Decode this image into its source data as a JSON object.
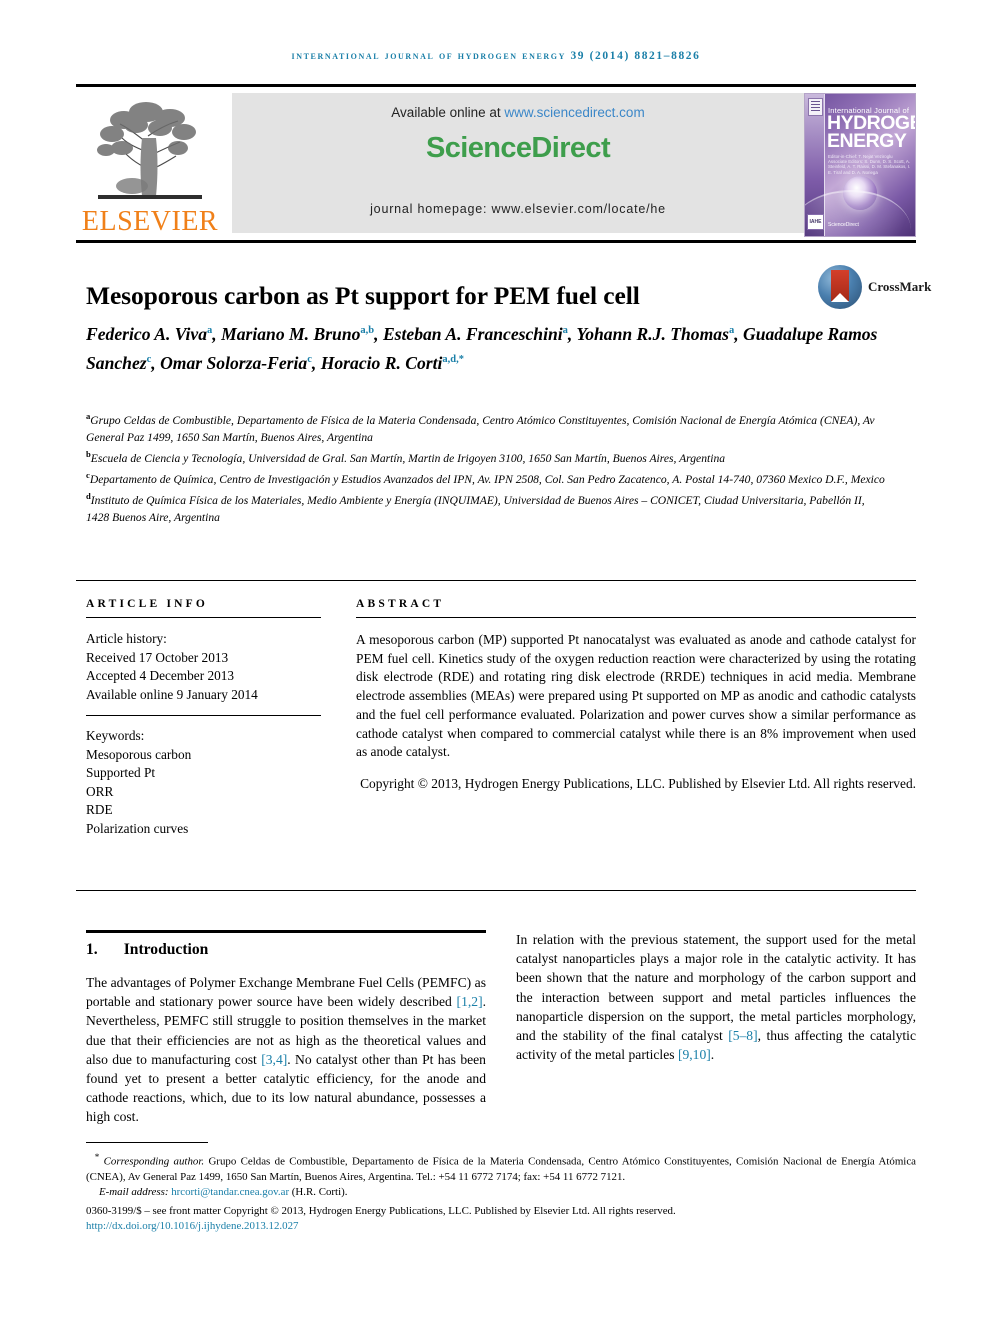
{
  "running_head": "International Journal of Hydrogen Energy 39 (2014) 8821–8826",
  "masthead": {
    "elsevier_wordmark": "ELSEVIER",
    "available_prefix": "Available online at ",
    "available_url": "www.sciencedirect.com",
    "sciencedirect_part1": "Science",
    "sciencedirect_part2": "Direct",
    "journal_homepage": "journal homepage: www.elsevier.com/locate/he",
    "cover": {
      "kicker": "International Journal of",
      "line1": "HYDROGEN",
      "line2": "ENERGY",
      "meta": "Editor-in-Chief: T. Nejat Veziroglu   Associate Editors: S. Dunn, D. S. Scott, A. Steinfeld, A. T. Raissi, D. M. Stefanakos, I. E. Tiraf and D. A. Noriega",
      "sd_badge": "ScienceDirect",
      "ihe_badge": "IAHE"
    }
  },
  "article": {
    "title": "Mesoporous carbon as Pt support for PEM fuel cell",
    "crossmark_label": "CrossMark",
    "authors": [
      {
        "name": "Federico A. Viva",
        "sup": "a",
        "sep": ", "
      },
      {
        "name": "Mariano M. Bruno",
        "sup": "a,b",
        "sep": ", "
      },
      {
        "name": "Esteban A. Franceschini",
        "sup": "a",
        "sep": ","
      },
      {
        "name": "Yohann R.J. Thomas",
        "sup": "a",
        "sep": ", "
      },
      {
        "name": "Guadalupe Ramos Sanchez",
        "sup": "c",
        "sep": ", "
      },
      {
        "name": "Omar Solorza-Feria",
        "sup": "c",
        "sep": ","
      },
      {
        "name": "Horacio R. Corti",
        "sup": "a,d,*",
        "sep": ""
      }
    ],
    "affiliations": [
      {
        "sup": "a",
        "text": "Grupo Celdas de Combustible, Departamento de Física de la Materia Condensada, Centro Atómico Constituyentes, Comisión Nacional de Energía Atómica (CNEA), Av General Paz 1499, 1650 San Martín, Buenos Aires, Argentina"
      },
      {
        "sup": "b",
        "text": "Escuela de Ciencia y Tecnología, Universidad de Gral. San Martín, Martin de Irigoyen 3100, 1650 San Martín, Buenos Aires, Argentina"
      },
      {
        "sup": "c",
        "text": "Departamento de Química, Centro de Investigación y Estudios Avanzados del IPN, Av. IPN 2508, Col. San Pedro Zacatenco, A. Postal 14-740, 07360 Mexico D.F., Mexico"
      },
      {
        "sup": "d",
        "text": "Instituto de Química Física de los Materiales, Medio Ambiente y Energía (INQUIMAE), Universidad de Buenos Aires – CONICET, Ciudad Universitaria, Pabellón II, 1428 Buenos Aire, Argentina"
      }
    ]
  },
  "article_info": {
    "heading": "ARTICLE INFO",
    "history_label": "Article history:",
    "received": "Received 17 October 2013",
    "accepted": "Accepted 4 December 2013",
    "available_online": "Available online 9 January 2014",
    "keywords_label": "Keywords:",
    "keywords": [
      "Mesoporous carbon",
      "Supported Pt",
      "ORR",
      "RDE",
      "Polarization curves"
    ]
  },
  "abstract": {
    "heading": "ABSTRACT",
    "body": "A mesoporous carbon (MP) supported Pt nanocatalyst was evaluated as anode and cathode catalyst for PEM fuel cell. Kinetics study of the oxygen reduction reaction were characterized by using the rotating disk electrode (RDE) and rotating ring disk electrode (RRDE) techniques in acid media. Membrane electrode assemblies (MEAs) were prepared using Pt supported on MP as anodic and cathodic catalysts and the fuel cell performance evaluated. Polarization and power curves show a similar performance as cathode catalyst when compared to commercial catalyst while there is an 8% improvement when used as anode catalyst.",
    "copyright": "Copyright © 2013, Hydrogen Energy Publications, LLC. Published by Elsevier Ltd. All rights reserved."
  },
  "introduction": {
    "number": "1.",
    "title": "Introduction",
    "para1_a": "The advantages of Polymer Exchange Membrane Fuel Cells (PEMFC) as portable and stationary power source have been widely described ",
    "ref1": "[1,2]",
    "para1_b": ". Nevertheless, PEMFC still struggle to position themselves in the market due that their efficiencies are not as high as the theoretical values and also due to manufacturing cost ",
    "ref2": "[3,4]",
    "para1_c": ". No catalyst other than Pt has been found yet to present a better catalytic efficiency, for the anode and cathode reactions, which, due to its low natural abundance, possesses a high cost.",
    "para2_a": "In relation with the previous statement, the support used for the metal catalyst nanoparticles plays a major role in the catalytic activity. It has been shown that the nature and morphology of the carbon support and the interaction between support and metal particles influences the nanoparticle dispersion on the support, the metal particles morphology, and the stability of the final catalyst ",
    "ref3": "[5–8]",
    "para2_b": ", thus affecting the catalytic activity of the metal particles ",
    "ref4": "[9,10]",
    "para2_c": "."
  },
  "footer": {
    "corresponding_marker": "*",
    "corresponding_italic": "Corresponding author.",
    "corresponding_text": " Grupo Celdas de Combustible, Departamento de Física de la Materia Condensada, Centro Atómico Constituyentes, Comisión Nacional de Energía Atómica (CNEA), Av General Paz 1499, 1650 San Martín, Buenos Aires, Argentina. Tel.: +54 11 6772 7174; fax: +54 11 6772 7121.",
    "email_label": "E-mail address: ",
    "email": "hrcorti@tandar.cnea.gov.ar",
    "email_owner": " (H.R. Corti).",
    "issn_line": "0360-3199/$ – see front matter Copyright © 2013, Hydrogen Energy Publications, LLC. Published by Elsevier Ltd. All rights reserved.",
    "doi": "http://dx.doi.org/10.1016/j.ijhydene.2013.12.027"
  },
  "colors": {
    "link": "#1a7fa8",
    "elsevier_orange": "#f08019",
    "sciencedirect_green": "#3e9e4c",
    "banner_gray": "#e3e3e3"
  }
}
